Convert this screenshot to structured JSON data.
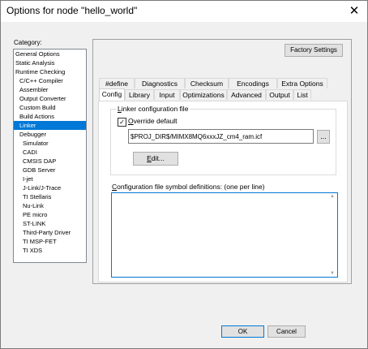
{
  "window": {
    "title": "Options for node \"hello_world\"",
    "close_glyph": "✕"
  },
  "category": {
    "label": "Category:",
    "items": [
      {
        "label": "General Options",
        "level": 0
      },
      {
        "label": "Static Analysis",
        "level": 0
      },
      {
        "label": "Runtime Checking",
        "level": 0
      },
      {
        "label": "C/C++ Compiler",
        "level": 1
      },
      {
        "label": "Assembler",
        "level": 1
      },
      {
        "label": "Output Converter",
        "level": 1
      },
      {
        "label": "Custom Build",
        "level": 1
      },
      {
        "label": "Build Actions",
        "level": 1
      },
      {
        "label": "Linker",
        "level": 1,
        "selected": true
      },
      {
        "label": "Debugger",
        "level": 1
      },
      {
        "label": "Simulator",
        "level": 2
      },
      {
        "label": "CADI",
        "level": 2
      },
      {
        "label": "CMSIS DAP",
        "level": 2
      },
      {
        "label": "GDB Server",
        "level": 2
      },
      {
        "label": "I-jet",
        "level": 2
      },
      {
        "label": "J-Link/J-Trace",
        "level": 2
      },
      {
        "label": "TI Stellaris",
        "level": 2
      },
      {
        "label": "Nu-Link",
        "level": 2
      },
      {
        "label": "PE micro",
        "level": 2
      },
      {
        "label": "ST-LINK",
        "level": 2
      },
      {
        "label": "Third-Party Driver",
        "level": 2
      },
      {
        "label": "TI MSP-FET",
        "level": 2
      },
      {
        "label": "TI XDS",
        "level": 2
      }
    ]
  },
  "factory_settings": "Factory Settings",
  "tabs_top": [
    "#define",
    "Diagnostics",
    "Checksum",
    "Encodings",
    "Extra Options"
  ],
  "tabs_bottom": [
    "Config",
    "Library",
    "Input",
    "Optimizations",
    "Advanced",
    "Output",
    "List"
  ],
  "active_tab": "Config",
  "config": {
    "group_title": "Linker configuration file",
    "override_label": "Override default",
    "override_checked": true,
    "path": "$PROJ_DIR$/MIMX8MQ6xxxJZ_cm4_ram.icf",
    "browse": "...",
    "edit": "Edit...",
    "defs_label": "Configuration file symbol definitions: (one per line)"
  },
  "footer": {
    "ok": "OK",
    "cancel": "Cancel"
  }
}
